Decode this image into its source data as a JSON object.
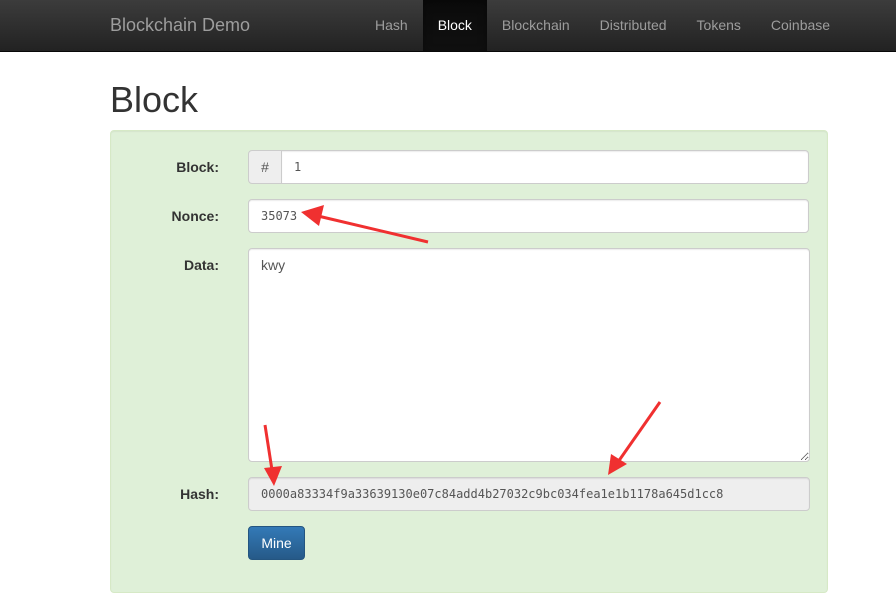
{
  "navbar": {
    "brand": "Blockchain Demo",
    "items": [
      {
        "label": "Hash"
      },
      {
        "label": "Block",
        "active": true
      },
      {
        "label": "Blockchain"
      },
      {
        "label": "Distributed"
      },
      {
        "label": "Tokens"
      },
      {
        "label": "Coinbase"
      }
    ]
  },
  "page": {
    "title": "Block"
  },
  "form": {
    "block_label": "Block:",
    "block_addon": "#",
    "block_value": "1",
    "nonce_label": "Nonce:",
    "nonce_value": "35073",
    "data_label": "Data:",
    "data_value": "kwy",
    "hash_label": "Hash:",
    "hash_value": "0000a83334f9a33639130e07c84add4b27032c9bc034fea1e1b1178a645d1cc8",
    "mine_label": "Mine"
  },
  "colors": {
    "annotation_arrow": "#f03030",
    "well_background": "#dff0d8",
    "button_primary": "#337ab7"
  }
}
